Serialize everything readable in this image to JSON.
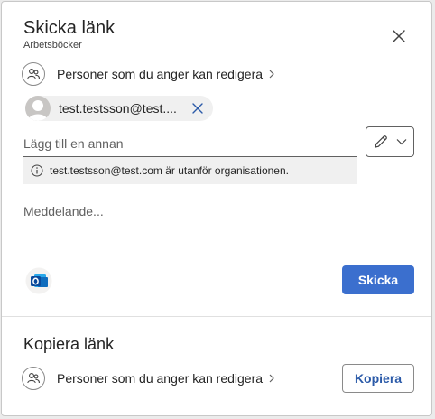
{
  "send_link": {
    "title": "Skicka länk",
    "subtitle": "Arbetsböcker",
    "permission_label": "Personer som du anger kan redigera",
    "recipient_chip_text": "test.testsson@test....",
    "add_placeholder": "Lägg till en annan",
    "warning_text": "test.testsson@test.com är utanför organisationen.",
    "message_placeholder": "Meddelande...",
    "send_label": "Skicka"
  },
  "copy_link": {
    "title": "Kopiera länk",
    "permission_label": "Personer som du anger kan redigera",
    "copy_label": "Kopiera"
  },
  "icons": {
    "close": "close-icon",
    "people": "people-icon",
    "chevron": "chevron-right-icon",
    "avatar": "person-avatar",
    "remove": "dismiss-icon",
    "pencil": "pencil-icon",
    "dropdown": "chevron-down-icon",
    "info": "info-icon",
    "outlook": "outlook-icon"
  },
  "colors": {
    "accent": "#3b6fce",
    "link_text": "#2b5aa8",
    "chip_bg": "#f0f0f0"
  }
}
